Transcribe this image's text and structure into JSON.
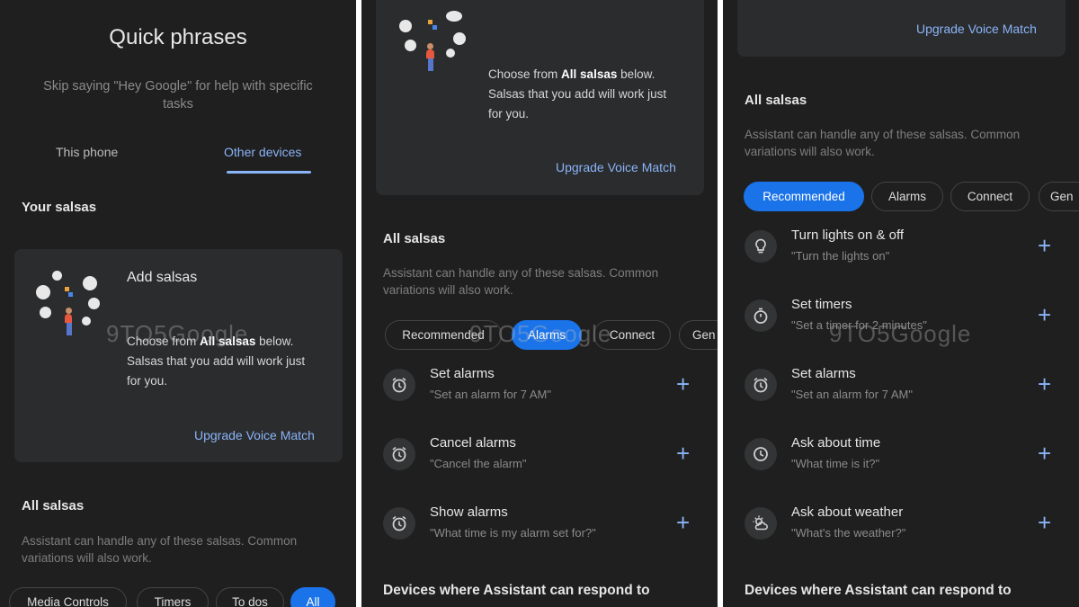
{
  "panel1": {
    "title": "Quick phrases",
    "subtitle_line1": "Skip saying \"Hey Google\" for help with specific",
    "subtitle_line2": "tasks",
    "tabs": [
      {
        "label": "This phone",
        "active": false
      },
      {
        "label": "Other devices",
        "active": true
      }
    ],
    "your_section": "Your salsas",
    "card": {
      "title": "Add salsas",
      "body_pre": "Choose from ",
      "body_bold": "All salsas",
      "body_post": " below.",
      "body_line2": "Salsas that you add will work just",
      "body_line3": "for you.",
      "link": "Upgrade Voice Match"
    },
    "all_section": "All salsas",
    "all_desc_line1": "Assistant can handle any of these salsas. Common",
    "all_desc_line2": "variations will also work.",
    "chips": [
      "Media Controls",
      "Timers",
      "To dos",
      "All"
    ],
    "watermark": "9TO5Google"
  },
  "panel2": {
    "card": {
      "body_pre": "Choose from ",
      "body_bold": "All salsas",
      "body_post": " below.",
      "body_line2": "Salsas that you add will work just",
      "body_line3": "for you.",
      "link": "Upgrade Voice Match"
    },
    "all_section": "All salsas",
    "all_desc_line1": "Assistant can handle any of these salsas. Common",
    "all_desc_line2": "variations will also work.",
    "chips": [
      "Recommended",
      "Alarms",
      "Connect",
      "Gen"
    ],
    "watermark": "9TO5Google",
    "items": [
      {
        "title": "Set alarms",
        "sub": "\"Set an alarm for 7 AM\"",
        "icon": "alarm-icon"
      },
      {
        "title": "Cancel alarms",
        "sub": "\"Cancel the alarm\"",
        "icon": "alarm-icon"
      },
      {
        "title": "Show alarms",
        "sub": "\"What time is my alarm set for?\"",
        "icon": "alarm-icon"
      }
    ],
    "devices_heading": "Devices where Assistant can respond to"
  },
  "panel3": {
    "link": "Upgrade Voice Match",
    "all_section": "All salsas",
    "all_desc_line1": "Assistant can handle any of these salsas. Common",
    "all_desc_line2": "variations will also work.",
    "chips": [
      "Recommended",
      "Alarms",
      "Connect",
      "Gen"
    ],
    "watermark": "9TO5Google",
    "items": [
      {
        "title": "Turn lights on & off",
        "sub": "\"Turn the lights on\"",
        "icon": "lightbulb-icon"
      },
      {
        "title": "Set timers",
        "sub": "\"Set a timer for 2 minutes\"",
        "icon": "timer-icon"
      },
      {
        "title": "Set alarms",
        "sub": "\"Set an alarm for 7 AM\"",
        "icon": "alarm-icon"
      },
      {
        "title": "Ask about time",
        "sub": "\"What time is it?\"",
        "icon": "clock-icon"
      },
      {
        "title": "Ask about weather",
        "sub": "\"What's the weather?\"",
        "icon": "weather-icon"
      }
    ],
    "devices_heading": "Devices where Assistant can respond to"
  },
  "colors": {
    "accent": "#8ab4f8",
    "chip_active": "#1a73e8",
    "background": "#1f1f1f",
    "card": "#2b2c2e"
  }
}
